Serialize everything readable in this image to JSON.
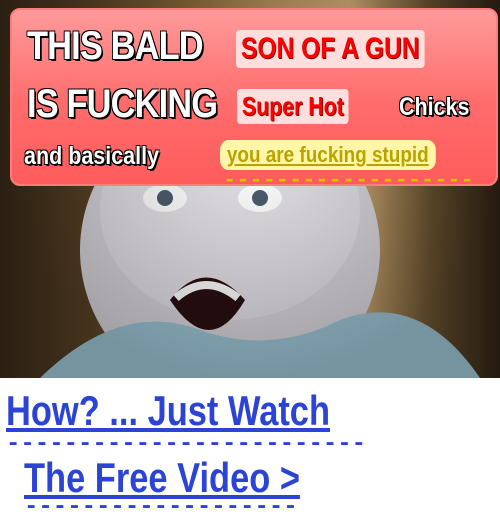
{
  "banner": {
    "line1_white": "THIS BALD",
    "line1_red": "SON OF A GUN",
    "line2_white": "IS FUCKING",
    "line2_red": "Super Hot",
    "line2_tail": "Chicks",
    "line3_white": "and basically",
    "line3_yellow": "you are fucking stupid",
    "dash_under_yellow": "-------------------"
  },
  "cta": {
    "line1": "How? ... Just Watch",
    "line1_dashes": "-------------------------",
    "line2": "The Free Video >",
    "line2_dashes": "-------------------"
  },
  "colors": {
    "banner_bg": "#ff6b6b",
    "red_text": "#ff0000",
    "yellow_pill": "#fff6a8",
    "link_blue": "#2b44d6"
  }
}
